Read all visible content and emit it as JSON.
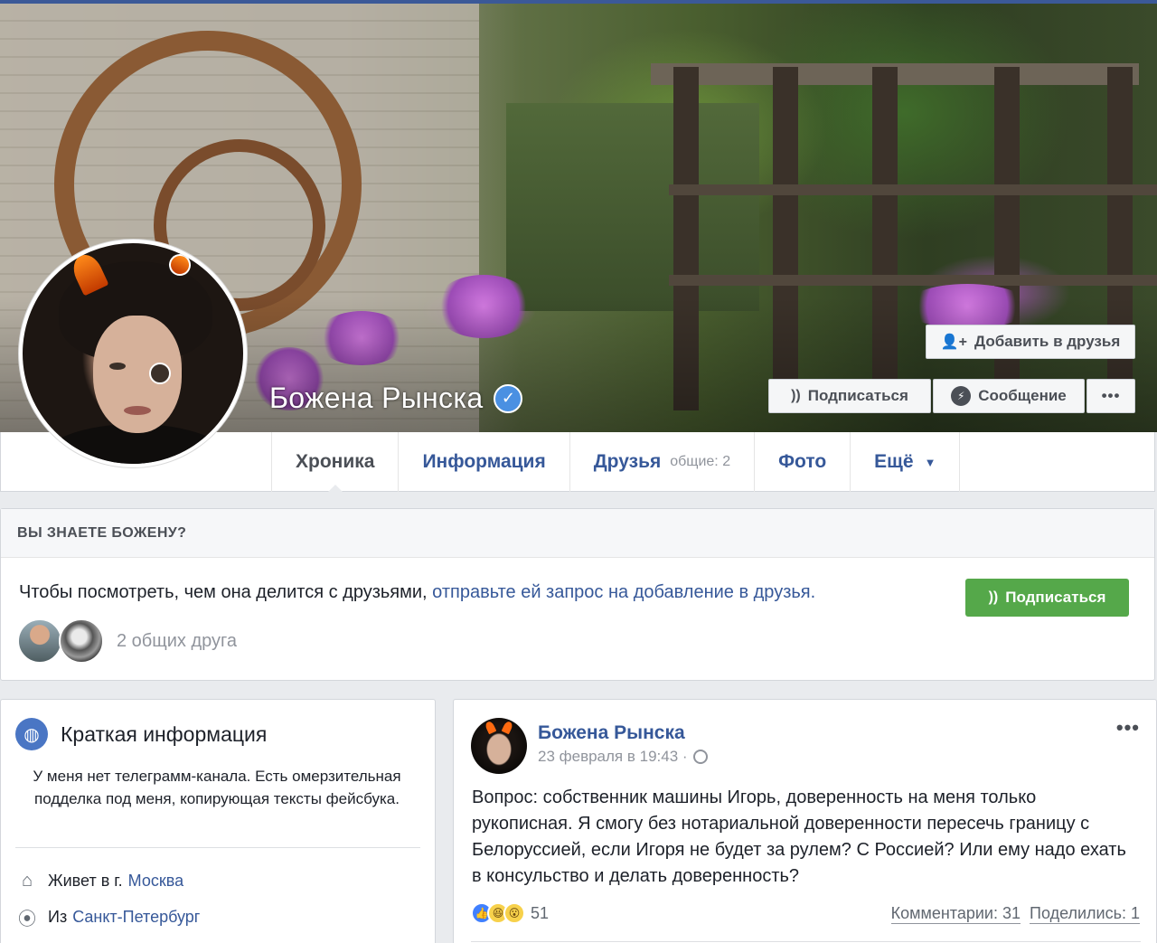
{
  "profile": {
    "name": "Божена Рынска",
    "verified": true
  },
  "cover_actions": {
    "add_friend": "Добавить в друзья",
    "follow": "Подписаться",
    "message": "Сообщение",
    "more": "•••"
  },
  "nav": {
    "tabs": [
      {
        "label": "Хроника",
        "active": true
      },
      {
        "label": "Информация"
      },
      {
        "label": "Друзья",
        "sub": "общие: 2"
      },
      {
        "label": "Фото"
      },
      {
        "label": "Ещё"
      }
    ]
  },
  "know_box": {
    "title": "ВЫ ЗНАЕТЕ БОЖЕНУ?",
    "text": "Чтобы посмотреть, чем она делится с друзьями, ",
    "link": "отправьте ей запрос на добавление в друзья.",
    "follow_button": "Подписаться",
    "mutual_friends": "2 общих друга"
  },
  "intro": {
    "title": "Краткая информация",
    "bio": "У меня нет телеграмм-канала. Есть омерзительная подделка под меня, копирующая тексты фейсбука.",
    "lives_label": "Живет в г.",
    "lives_city": "Москва",
    "from_label": "Из",
    "from_city": "Санкт-Петербург"
  },
  "post": {
    "author": "Божена Рынска",
    "time": "23 февраля в 19:43 ·",
    "text": "Вопрос: собственник машины Игорь, доверенность на меня только рукописная. Я смогу без нотариальной доверенности пересечь границу с Белоруссией, если Игоря не будет за рулем? С Россией? Или ему надо ехать в консульство и делать доверенность?",
    "reactions_count": "51",
    "comments": "Комментарии: 31",
    "shares": "Поделились: 1",
    "more": "•••"
  },
  "colors": {
    "link": "#365899",
    "green_button": "#55a84a",
    "top_bar": "#3b5998"
  }
}
